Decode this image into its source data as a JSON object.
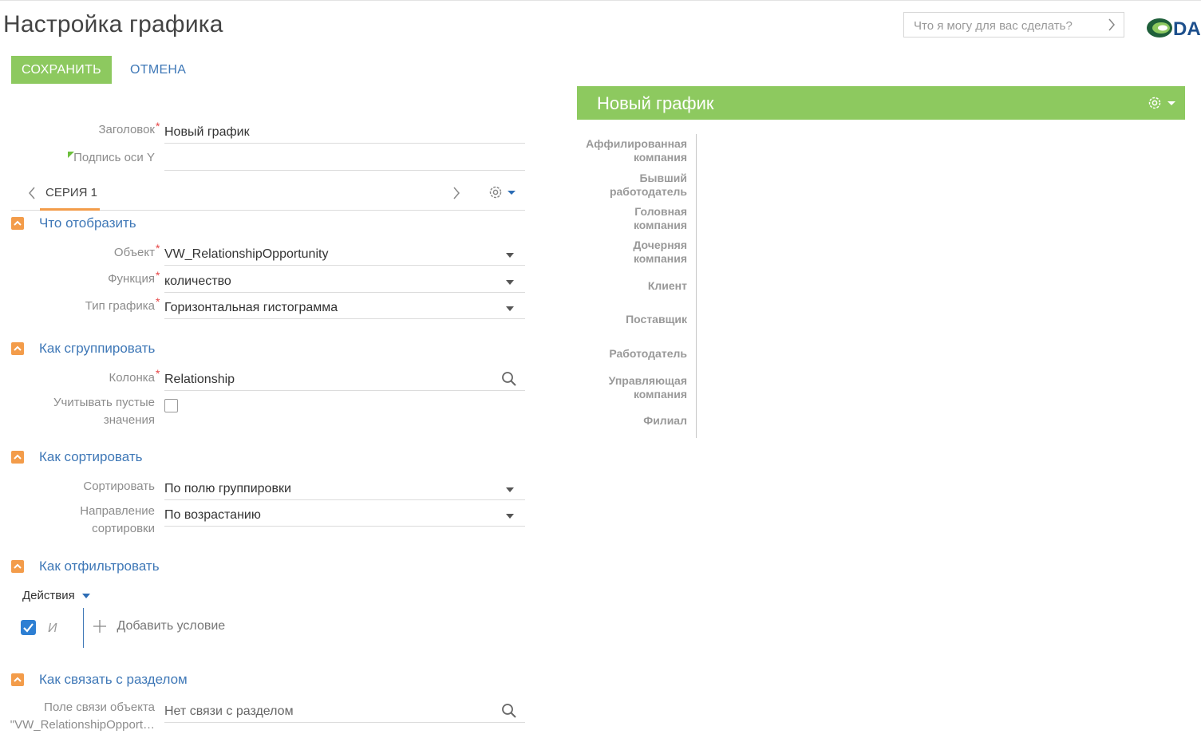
{
  "page": {
    "title": "Настройка графика"
  },
  "command_line": {
    "placeholder": "Что я могу для вас сделать?"
  },
  "toolbar": {
    "save_label": "СОХРАНИТЬ",
    "cancel_label": "ОТМЕНА"
  },
  "general": {
    "title_label": "Заголовок",
    "title_value": "Новый график",
    "y_axis_label": "Подпись оси Y",
    "y_axis_value": ""
  },
  "series_tab": {
    "label": "СЕРИЯ 1"
  },
  "sections": {
    "what": {
      "title": "Что отобразить",
      "object_label": "Объект",
      "object_value": "VW_RelationshipOpportunity",
      "function_label": "Функция",
      "function_value": "количество",
      "type_label": "Тип графика",
      "type_value": "Горизонтальная гистограмма"
    },
    "group": {
      "title": "Как сгруппировать",
      "column_label": "Колонка",
      "column_value": "Relationship",
      "empty_label_1": "Учитывать пустые",
      "empty_label_2": "значения",
      "empty_checked": false
    },
    "sort": {
      "title": "Как сортировать",
      "sort_label": "Сортировать",
      "sort_value": "По полю группировки",
      "dir_label_1": "Направление",
      "dir_label_2": "сортировки",
      "dir_value": "По возрастанию"
    },
    "filter": {
      "title": "Как отфильтровать",
      "actions_label": "Действия",
      "and_label": "И",
      "add_condition": "Добавить условие"
    },
    "link": {
      "title": "Как связать с разделом",
      "field_label_1": "Поле связи объекта",
      "field_label_2": "\"VW_RelationshipOpport…",
      "field_value": "Нет связи с разделом"
    }
  },
  "colors": {
    "accent_green": "#8dc95f",
    "link_blue": "#3f78b7",
    "section_orange": "#f39c4a"
  },
  "chart_data": {
    "type": "bar",
    "orientation": "horizontal",
    "title": "Новый график",
    "categories": [
      [
        "Аффилированная",
        "компания"
      ],
      [
        "Бывший",
        "работодатель"
      ],
      [
        "Головная",
        "компания"
      ],
      [
        "Дочерняя",
        "компания"
      ],
      [
        "Клиент"
      ],
      [
        "Поставщик"
      ],
      [
        "Работодатель"
      ],
      [
        "Управляющая",
        "компания"
      ],
      [
        "Филиал"
      ]
    ],
    "values": [
      0,
      0,
      0,
      0,
      0,
      0,
      0,
      0,
      0
    ]
  }
}
